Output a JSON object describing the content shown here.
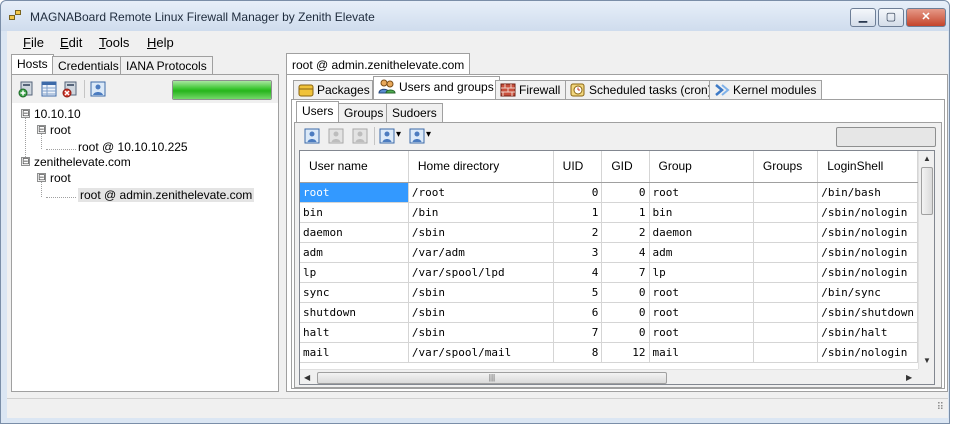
{
  "window": {
    "title": "MAGNABoard Remote Linux Firewall Manager by Zenith Elevate",
    "buttons": {
      "minimize": "▁",
      "maximize": "▢",
      "close": "✕"
    }
  },
  "menu": [
    {
      "key": "F",
      "rest": "ile"
    },
    {
      "key": "E",
      "rest": "dit"
    },
    {
      "key": "T",
      "rest": "ools"
    },
    {
      "key": "H",
      "rest": "elp"
    }
  ],
  "left_tabs": [
    "Hosts",
    "Credentials",
    "IANA Protocols"
  ],
  "left_toolbar": {
    "icons": [
      "add-host-icon",
      "credentials-icon",
      "remove-host-icon",
      "picture-icon"
    ],
    "progress_fraction": 1.0
  },
  "tree": [
    {
      "label": "10.10.10",
      "level": 0,
      "expander": "⊟"
    },
    {
      "label": "root",
      "level": 1,
      "expander": "⊟"
    },
    {
      "label": "root @ 10.10.10.225",
      "level": 2
    },
    {
      "label": "zenithelevate.com",
      "level": 0,
      "expander": "⊟"
    },
    {
      "label": "root",
      "level": 1,
      "expander": "⊟"
    },
    {
      "label": "root @ admin.zenithelevate.com",
      "level": 2,
      "selected": true
    }
  ],
  "session_tab": "root @ admin.zenithelevate.com",
  "feature_tabs": [
    {
      "label": "Packages",
      "icon": "packages-icon"
    },
    {
      "label": "Users and groups",
      "icon": "users-icon"
    },
    {
      "label": "Firewall",
      "icon": "firewall-icon"
    },
    {
      "label": "Scheduled tasks (cron)",
      "icon": "clock-icon"
    },
    {
      "label": "Kernel modules",
      "icon": "kernel-icon"
    }
  ],
  "sub_tabs": [
    "Users",
    "Groups",
    "Sudoers"
  ],
  "users_toolbar": {
    "icons": [
      "add-user-icon",
      "edit-user-icon",
      "delete-user-icon",
      "user-actions-dropdown-icon",
      "export-dropdown-icon"
    ],
    "dropdown_arrow": "▾"
  },
  "users_table": {
    "columns": [
      "User name",
      "Home directory",
      "UID",
      "GID",
      "Group",
      "Groups",
      "LoginShell"
    ],
    "rows": [
      [
        "root",
        "/root",
        "0",
        "0",
        "root",
        "",
        "/bin/bash"
      ],
      [
        "bin",
        "/bin",
        "1",
        "1",
        "bin",
        "",
        "/sbin/nologin"
      ],
      [
        "daemon",
        "/sbin",
        "2",
        "2",
        "daemon",
        "",
        "/sbin/nologin"
      ],
      [
        "adm",
        "/var/adm",
        "3",
        "4",
        "adm",
        "",
        "/sbin/nologin"
      ],
      [
        "lp",
        "/var/spool/lpd",
        "4",
        "7",
        "lp",
        "",
        "/sbin/nologin"
      ],
      [
        "sync",
        "/sbin",
        "5",
        "0",
        "root",
        "",
        "/bin/sync"
      ],
      [
        "shutdown",
        "/sbin",
        "6",
        "0",
        "root",
        "",
        "/sbin/shutdown"
      ],
      [
        "halt",
        "/sbin",
        "7",
        "0",
        "root",
        "",
        "/sbin/halt"
      ],
      [
        "mail",
        "/var/spool/mail",
        "8",
        "12",
        "mail",
        "",
        "/sbin/nologin"
      ]
    ]
  },
  "scroll_glyphs": {
    "up": "▲",
    "down": "▼",
    "left": "◀",
    "right": "▶",
    "grip": "|||",
    "resize": "⠿"
  }
}
